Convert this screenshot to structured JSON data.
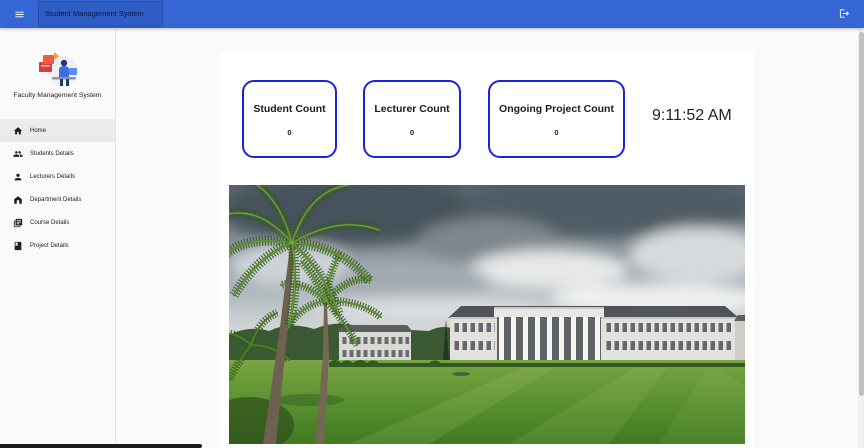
{
  "app": {
    "title": "Student Management System",
    "menu_icon": "menu-icon",
    "logout_icon": "logout-icon"
  },
  "sidebar": {
    "brand": "Faculty Management System",
    "logo_icon": "faculty-logo",
    "items": [
      {
        "label": "Home",
        "icon": "home-icon",
        "active": true
      },
      {
        "label": "Students Details",
        "icon": "people-icon",
        "active": false
      },
      {
        "label": "Lecturers Details",
        "icon": "person-icon",
        "active": false
      },
      {
        "label": "Department Details",
        "icon": "building-icon",
        "active": false
      },
      {
        "label": "Course Details",
        "icon": "library-books-icon",
        "active": false
      },
      {
        "label": "Project Details",
        "icon": "book-icon",
        "active": false
      }
    ]
  },
  "dashboard": {
    "cards": [
      {
        "label": "Student Count",
        "value": "0"
      },
      {
        "label": "Lecturer Count",
        "value": "0"
      },
      {
        "label": "Ongoing Project Count",
        "value": "0"
      }
    ],
    "clock": "9:11:52 AM"
  },
  "colors": {
    "topbar": "#3566d3",
    "title_box": "#2e5dc6",
    "card_border": "#1f1fe0",
    "sidebar_bg": "#fafafa",
    "active_item_bg": "#ebebeb"
  }
}
